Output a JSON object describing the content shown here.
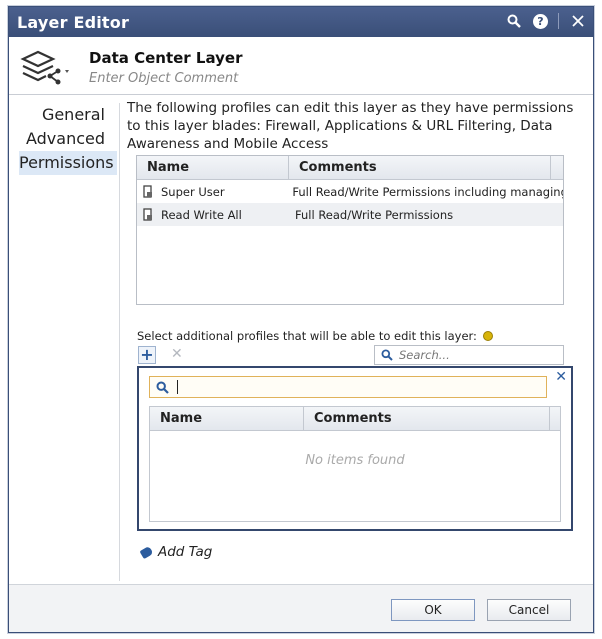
{
  "window": {
    "title": "Layer Editor"
  },
  "header": {
    "name": "Data Center Layer",
    "comment_placeholder": "Enter Object Comment"
  },
  "nav": {
    "items": [
      {
        "label": "General"
      },
      {
        "label": "Advanced"
      },
      {
        "label": "Permissions"
      }
    ],
    "active": "Permissions"
  },
  "permissions": {
    "description": "The following profiles can edit this layer as they have permissions to this layer blades: Firewall, Applications & URL Filtering, Data Awareness and Mobile Access",
    "table": {
      "columns": [
        "Name",
        "Comments"
      ],
      "rows": [
        {
          "name": "Super User",
          "comment": "Full Read/Write Permissions including managing"
        },
        {
          "name": "Read Write All",
          "comment": "Full Read/Write Permissions"
        }
      ]
    },
    "select_label": "Select additional profiles that will be able to edit this layer:",
    "search_placeholder": "Search...",
    "popup": {
      "columns": [
        "Name",
        "Comments"
      ],
      "empty_text": "No items found"
    },
    "add_tag": "Add Tag"
  },
  "footer": {
    "ok": "OK",
    "cancel": "Cancel"
  },
  "colors": {
    "titlebar": "#3a4f78",
    "active_nav": "#dce8f6",
    "accent": "#2c5c9e"
  },
  "icons": [
    "search-icon",
    "help-icon",
    "close-icon",
    "layers-icon",
    "user-icon",
    "plus-icon",
    "remove-icon",
    "bulb-icon",
    "tag-icon"
  ]
}
